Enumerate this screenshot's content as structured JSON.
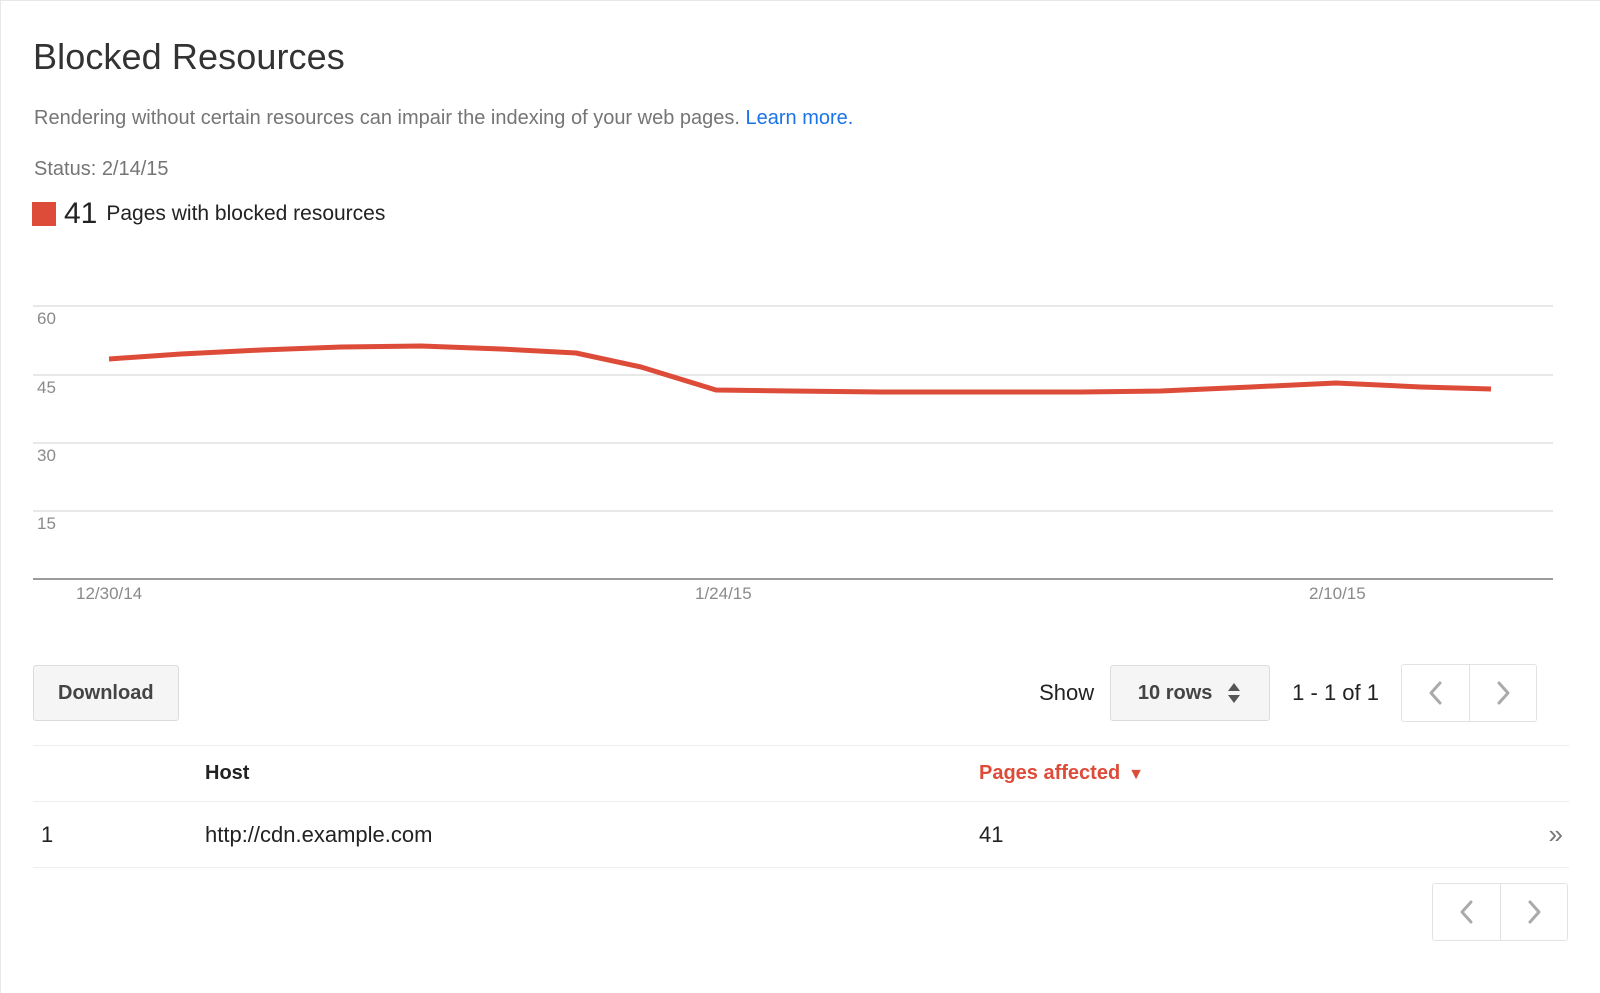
{
  "header": {
    "title": "Blocked Resources",
    "subtitle_text": "Rendering without certain resources can impair the indexing of your web pages.",
    "learn_more_label": "Learn more.",
    "status_label": "Status: 2/14/15"
  },
  "legend": {
    "swatch_color": "#dd4b39",
    "count": "41",
    "label": "Pages with blocked resources"
  },
  "chart_data": {
    "type": "line",
    "title": "",
    "xlabel": "",
    "ylabel": "",
    "series": [
      {
        "name": "Pages with blocked resources",
        "color": "#dd4b39",
        "values": [
          49,
          50,
          51,
          52,
          53,
          53,
          52,
          51,
          50,
          48,
          45,
          44,
          44,
          44,
          44,
          44,
          44,
          44,
          44,
          44,
          44,
          44,
          44,
          45,
          46,
          47,
          46,
          45,
          45
        ]
      }
    ],
    "x": [
      "12/30/14",
      "1/1/15",
      "1/3/15",
      "1/5/15",
      "1/7/15",
      "1/9/15",
      "1/11/15",
      "1/13/15",
      "1/15/15",
      "1/17/15",
      "1/19/15",
      "1/21/15",
      "1/24/15",
      "1/26/15",
      "1/28/15",
      "1/30/15",
      "2/1/15",
      "2/3/15",
      "2/5/15",
      "2/7/15",
      "2/8/15",
      "2/9/15",
      "2/10/15",
      "2/11/15",
      "2/12/15",
      "2/13/15",
      "2/14/15",
      "2/15/15",
      "2/16/15"
    ],
    "xtick_labels": [
      "12/30/14",
      "1/24/15",
      "2/10/15"
    ],
    "ytick_labels": [
      "60",
      "45",
      "30",
      "15"
    ],
    "yticks": [
      60,
      45,
      30,
      15
    ],
    "ylim": [
      0,
      68
    ],
    "grid": true,
    "legend_position": "above-chart"
  },
  "toolbar": {
    "download_label": "Download",
    "show_label": "Show",
    "rows_value": "10 rows",
    "range_label": "1 - 1 of 1",
    "prev_icon": "chevron-left-icon",
    "next_icon": "chevron-right-icon"
  },
  "table": {
    "columns": [
      "",
      "Host",
      "Pages affected",
      ""
    ],
    "sort_column": "Pages affected",
    "sort_direction_glyph": "▼",
    "rows": [
      {
        "index": "1",
        "host": "http://cdn.example.com",
        "pages_affected": "41",
        "more_glyph": "»"
      }
    ]
  },
  "bottom_pager": {
    "prev_icon": "chevron-left-icon",
    "next_icon": "chevron-right-icon"
  }
}
